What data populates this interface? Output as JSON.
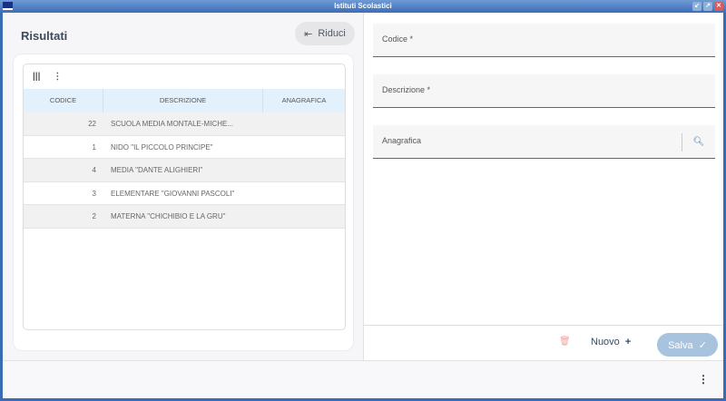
{
  "window": {
    "title": "Istituti Scolastici",
    "buttons": [
      "minimize",
      "maximize",
      "close"
    ]
  },
  "left": {
    "title": "Risultati",
    "collapse_label": "Riduci",
    "table": {
      "columns": [
        "CODICE",
        "DESCRIZIONE",
        "ANAGRAFICA"
      ],
      "rows": [
        {
          "codice": "22",
          "descrizione": "SCUOLA MEDIA MONTALE-MICHE...",
          "anagrafica": ""
        },
        {
          "codice": "1",
          "descrizione": "NIDO \"IL PICCOLO PRINCIPE\"",
          "anagrafica": ""
        },
        {
          "codice": "4",
          "descrizione": "MEDIA \"DANTE ALIGHIERI\"",
          "anagrafica": ""
        },
        {
          "codice": "3",
          "descrizione": "ELEMENTARE \"GIOVANNI PASCOLI\"",
          "anagrafica": ""
        },
        {
          "codice": "2",
          "descrizione": "MATERNA \"CHICHIBIO E LA GRU\"",
          "anagrafica": ""
        }
      ]
    }
  },
  "form": {
    "codice_label": "Codice *",
    "descrizione_label": "Descrizione *",
    "anagrafica_label": "Anagrafica"
  },
  "footer": {
    "nuovo": "Nuovo",
    "salva": "Salva"
  },
  "colors": {
    "titlebar": "#3d6db5",
    "header": "#e3f1fc",
    "salva": "#a8c3de",
    "delete": "#f1a1a1"
  }
}
